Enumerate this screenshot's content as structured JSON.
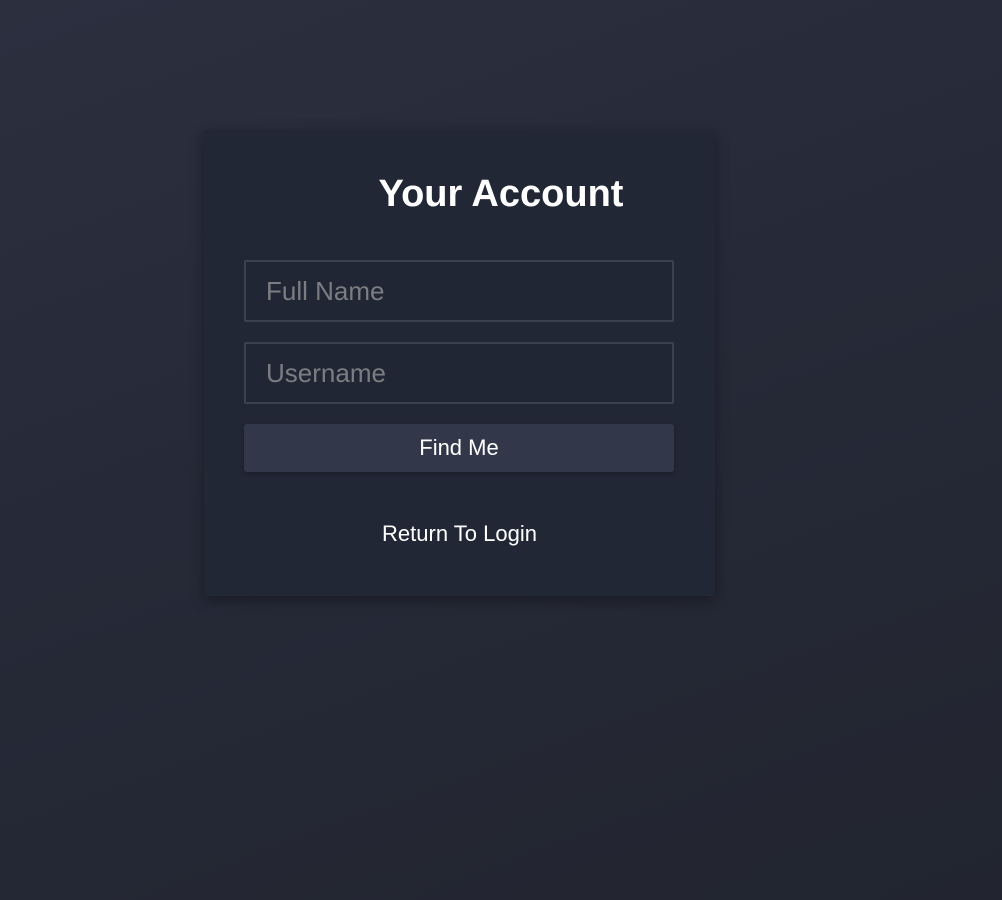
{
  "form": {
    "title": "Your Account",
    "full_name": {
      "placeholder": "Full Name",
      "value": ""
    },
    "username": {
      "placeholder": "Username",
      "value": ""
    },
    "submit_label": "Find Me",
    "return_link_label": "Return To Login"
  },
  "colors": {
    "background": "#272b39",
    "card": "#222735",
    "field_border": "#3b4150",
    "button": "#323849",
    "text": "#ffffff",
    "placeholder": "#7b7d82"
  }
}
